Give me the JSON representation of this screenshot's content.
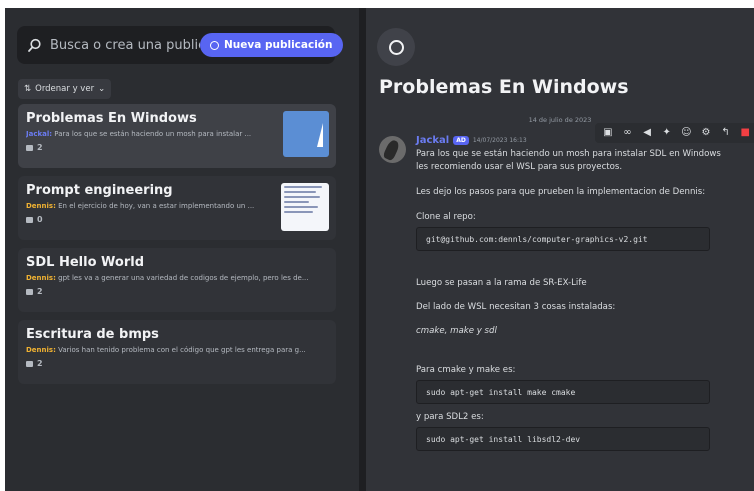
{
  "search": {
    "placeholder": "Busca o crea una publicació"
  },
  "new_post_label": "Nueva publicación",
  "sort_label": "Ordenar y ver",
  "posts": [
    {
      "title": "Problemas En Windows",
      "author": "Jackal:",
      "author_color": "#6b7cf2",
      "preview": "Para los que se están haciendo un mosh para instalar ...",
      "count": "2"
    },
    {
      "title": "Prompt engineering",
      "author": "Dennis:",
      "author_color": "#f0b232",
      "preview": "En el ejercicio de hoy, van a estar implementando un ...",
      "count": "0"
    },
    {
      "title": "SDL Hello World",
      "author": "Dennis:",
      "author_color": "#f0b232",
      "preview": "gpt les va a generar una variedad de codigos de ejemplo, pero les de...",
      "count": "2"
    },
    {
      "title": "Escritura de bmps",
      "author": "Dennis:",
      "author_color": "#f0b232",
      "preview": "Varios han tenido problema con el código que gpt les entrega para g...",
      "count": "2"
    }
  ],
  "thread": {
    "title": "Problemas En Windows",
    "date_divider": "14 de julio de 2023",
    "message": {
      "author": "Jackal",
      "badge": "AD",
      "timestamp": "14/07/2023 16:13",
      "line1": "Para los que se están haciendo un mosh para instalar SDL en Windows",
      "line2": "les recomiendo usar el WSL para sus proyectos.",
      "line3": "Les dejo los pasos para que prueben la implementacion de Dennis:",
      "line4": "Clone al repo:",
      "code1": "git@github.com:dennls/computer-graphics-v2.git",
      "line5": "Luego se pasan a la rama de SR-EX-Life",
      "line6": "Del lado de WSL necesitan 3 cosas instaladas:",
      "line7": "cmake, make y sdl",
      "line8": "Para cmake y make es:",
      "code2": "sudo apt-get install make cmake",
      "line9": "y para SDL2 es:",
      "code3": "sudo apt-get install libsdl2-dev"
    }
  },
  "colors": {
    "accent": "#5865f2",
    "delete": "#f23f43"
  }
}
